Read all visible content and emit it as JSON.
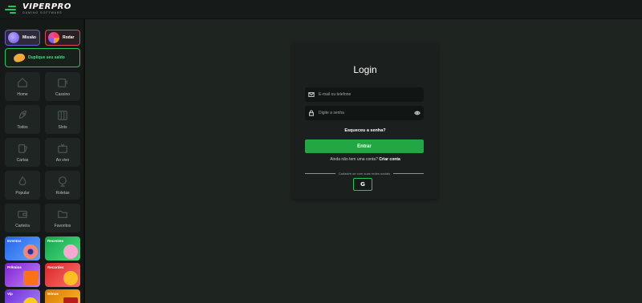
{
  "brand": {
    "title": "VIPERPRO",
    "subtitle": "GAMING SOFTWARE"
  },
  "sidebar": {
    "quick": [
      {
        "label": "Missão",
        "icon": "mission-icon"
      },
      {
        "label": "Rodar",
        "icon": "wheel-icon"
      }
    ],
    "double_balance": "Duplique seu saldo",
    "tiles": [
      {
        "label": "Home",
        "icon": "home-icon"
      },
      {
        "label": "Cassino",
        "icon": "slot-machine-icon"
      },
      {
        "label": "Todos",
        "icon": "rocket-icon"
      },
      {
        "label": "Slots",
        "icon": "slots-icon"
      },
      {
        "label": "Cartas",
        "icon": "cards-icon"
      },
      {
        "label": "Ao vivo",
        "icon": "live-icon"
      },
      {
        "label": "Popular",
        "icon": "fire-icon"
      },
      {
        "label": "Roletas",
        "icon": "roulette-icon"
      },
      {
        "label": "Carteira",
        "icon": "wallet-icon"
      },
      {
        "label": "Favoritos",
        "icon": "folder-icon"
      }
    ],
    "promos": [
      {
        "label": "Eventos",
        "color": "#3b82f6"
      },
      {
        "label": "Recentes",
        "color": "#22c55e"
      },
      {
        "label": "Prêmios",
        "color": "#a855f7"
      },
      {
        "label": "Recordes",
        "color": "#ef4444"
      },
      {
        "label": "Vip",
        "color": "#7c3aed"
      },
      {
        "label": "Bônus",
        "color": "#f59e0b"
      }
    ]
  },
  "login": {
    "title": "Login",
    "email_placeholder": "E-mail ou telefone",
    "password_placeholder": "Digite a senha",
    "forgot": "Esqueceu a senha?",
    "submit": "Entrar",
    "no_account": "Ainda não tem uma conta?",
    "create": "Criar conta",
    "social_divider": "Cadastre-se com suas redes sociais",
    "google": "G"
  },
  "colors": {
    "accent": "#22c55e",
    "background": "#1e2420",
    "sidebar": "#151917"
  }
}
